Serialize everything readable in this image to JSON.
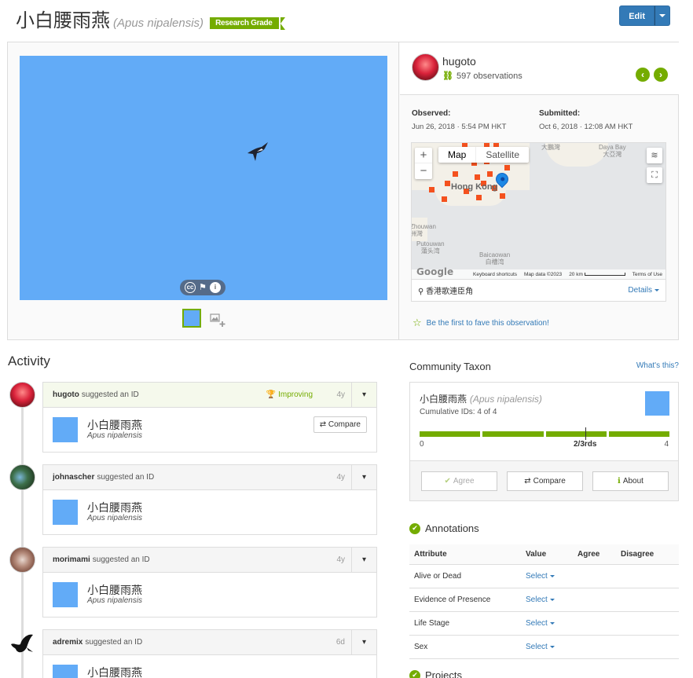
{
  "header": {
    "common_name": "小白腰雨燕",
    "scientific_name": "(Apus nipalensis)",
    "quality_badge": "Research Grade",
    "edit_label": "Edit"
  },
  "observer": {
    "username": "hugoto",
    "observations": "597 observations"
  },
  "dates": {
    "observed_label": "Observed:",
    "observed_value": "Jun 26, 2018 · 5:54 PM HKT",
    "submitted_label": "Submitted:",
    "submitted_value": "Oct 6, 2018 · 12:08 AM HKT"
  },
  "map": {
    "type_map": "Map",
    "type_satellite": "Satellite",
    "zoom_in": "+",
    "zoom_out": "−",
    "labels": {
      "hong_kong": "Hong Kong",
      "tai_pang": "大鵬灣",
      "daya_bay": "Daya Bay",
      "daya_bay_cn": "大亞灣",
      "zhouwan": "Zhouwan",
      "zhouwan_cn": "洲灣",
      "putouwan": "Putouwan",
      "putouwan_cn": "蒲头湾",
      "baicaowan": "Baicaowan",
      "baicaowan_cn": "白槽湾"
    },
    "footer": {
      "keyboard": "Keyboard shortcuts",
      "data": "Map data ©2023",
      "scale": "20 km",
      "terms": "Terms of Use",
      "google": "Google"
    },
    "place": "香港歌連臣角",
    "details": "Details"
  },
  "fave_text": "Be the first to fave this observation!",
  "activity": {
    "title": "Activity",
    "items": [
      {
        "user": "hugoto",
        "verb": "suggested an ID",
        "ago": "4y",
        "improving": "Improving",
        "name": "小白腰雨燕",
        "sci": "Apus nipalensis",
        "compare": "Compare"
      },
      {
        "user": "johnascher",
        "verb": "suggested an ID",
        "ago": "4y",
        "name": "小白腰雨燕",
        "sci": "Apus nipalensis"
      },
      {
        "user": "morimami",
        "verb": "suggested an ID",
        "ago": "4y",
        "name": "小白腰雨燕",
        "sci": "Apus nipalensis"
      },
      {
        "user": "adremix",
        "verb": "suggested an ID",
        "ago": "6d",
        "name": "小白腰雨燕",
        "sci": ""
      }
    ]
  },
  "community": {
    "title": "Community Taxon",
    "whats_this": "What's this?",
    "name": "小白腰雨燕",
    "sci": "(Apus nipalensis)",
    "cumulative": "Cumulative IDs: 4 of 4",
    "scale_min": "0",
    "scale_mid": "2/3rds",
    "scale_max": "4",
    "agree": "Agree",
    "compare": "Compare",
    "about": "About"
  },
  "annotations": {
    "title": "Annotations",
    "headers": [
      "Attribute",
      "Value",
      "Agree",
      "Disagree"
    ],
    "rows": [
      {
        "attr": "Alive or Dead",
        "value": "Select"
      },
      {
        "attr": "Evidence of Presence",
        "value": "Select"
      },
      {
        "attr": "Life Stage",
        "value": "Select"
      },
      {
        "attr": "Sex",
        "value": "Select"
      }
    ]
  },
  "projects_title": "Projects",
  "colors": {
    "accent_green": "#74ac00",
    "link_blue": "#337ab7",
    "sky_blue": "#62abf7",
    "observation_marker": "#f4511e"
  }
}
